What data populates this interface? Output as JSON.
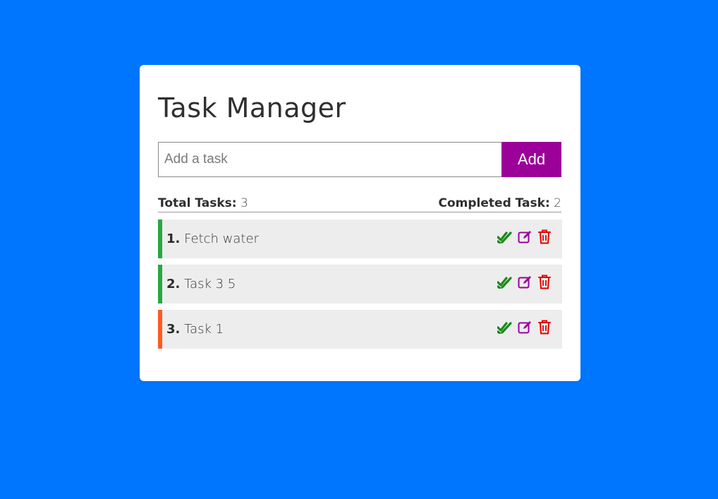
{
  "title": "Task Manager",
  "input": {
    "placeholder": "Add a task",
    "value": ""
  },
  "add_button": "Add",
  "stats": {
    "total_label": "Total Tasks:",
    "total_value": "3",
    "completed_label": "Completed Task:",
    "completed_value": "2"
  },
  "tasks": [
    {
      "index": "1.",
      "text": "Fetch water",
      "status": "completed"
    },
    {
      "index": "2.",
      "text": "Task 3 5",
      "status": "completed"
    },
    {
      "index": "3.",
      "text": "Task 1",
      "status": "pending"
    }
  ],
  "icons": {
    "complete": "double-check-icon",
    "edit": "edit-icon",
    "delete": "trash-icon"
  },
  "colors": {
    "background": "#0076ff",
    "add_button": "#9b0098",
    "completed_bar": "#28a745",
    "pending_bar": "#ff5a1f",
    "check_icon": "#1a8a1a",
    "edit_icon": "#9b0098",
    "delete_icon": "#e00000"
  }
}
